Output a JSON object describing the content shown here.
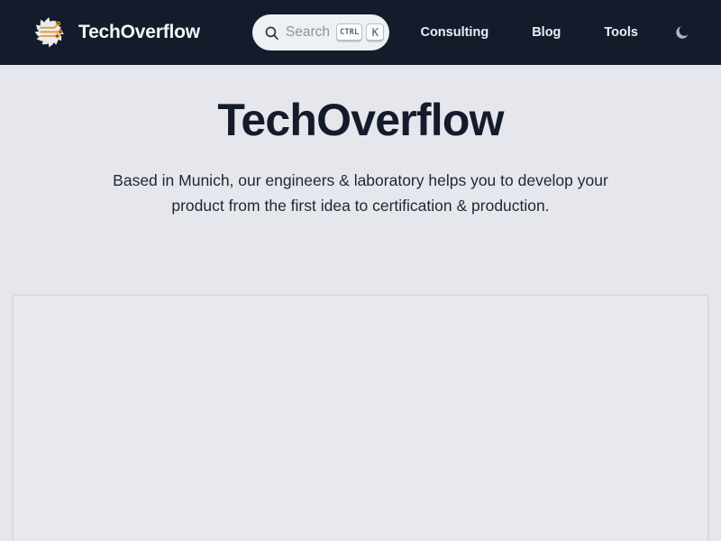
{
  "header": {
    "brand": {
      "name": "TechOverflow",
      "logo_icon": "gear-circuit-logo"
    },
    "search": {
      "icon": "search-icon",
      "placeholder": "Search",
      "shortcut_modifier": "CTRL",
      "shortcut_key": "K"
    },
    "nav_items": [
      {
        "label": "Consulting"
      },
      {
        "label": "Blog"
      },
      {
        "label": "Tools"
      }
    ],
    "theme_toggle": {
      "icon": "moon-icon"
    },
    "colors": {
      "background": "#141b2b",
      "text": "#edeff3",
      "accent": "#e8921e"
    }
  },
  "hero": {
    "title": "TechOverflow",
    "subtitle": "Based in Munich, our engineers & laboratory helps you to develop your product from the first idea to certification & production."
  },
  "page": {
    "background": "#e5e7ec",
    "panel_background": "#e7e9ed"
  }
}
